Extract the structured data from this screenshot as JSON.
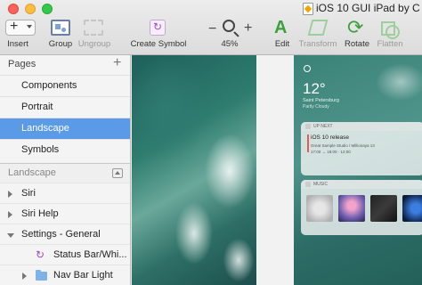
{
  "window": {
    "title": "iOS 10 GUI iPad by C"
  },
  "toolbar": {
    "insert_label": "Insert",
    "group_label": "Group",
    "ungroup_label": "Ungroup",
    "create_symbol_label": "Create Symbol",
    "zoom_minus": "−",
    "zoom_plus": "+",
    "zoom_level": "45%",
    "edit_label": "Edit",
    "transform_label": "Transform",
    "rotate_label": "Rotate",
    "flatten_label": "Flatten",
    "icons": [
      "plus-icon",
      "group-icon",
      "ungroup-icon",
      "create-symbol-icon",
      "zoom-icon",
      "edit-icon",
      "transform-icon",
      "rotate-icon",
      "flatten-icon"
    ]
  },
  "sidebar": {
    "pages_title": "Pages",
    "pages": [
      {
        "label": "Components"
      },
      {
        "label": "Portrait"
      },
      {
        "label": "Landscape",
        "selected": true
      },
      {
        "label": "Symbols"
      }
    ],
    "layers_title": "Landscape",
    "layers": [
      {
        "label": "Siri"
      },
      {
        "label": "Siri Help"
      },
      {
        "label": "Settings - General",
        "expanded": true
      },
      {
        "label": "Status Bar/Whi..."
      },
      {
        "label": "Nav Bar Light"
      }
    ]
  },
  "canvas": {
    "temperature": "12°",
    "city": "Saint Petersburg",
    "weather_detail": "Partly Cloudy",
    "up_next_header": "UP NEXT",
    "event_title": "iOS 10 release",
    "event_line1": "Great Sample Studio / Millionaya 13",
    "event_line2": "17:00 → 18:00 · 12:00",
    "music_header": "MUSIC"
  },
  "colors": {
    "selection": "#5b9ae6",
    "accent_green": "#3ca13c",
    "symbol_purple": "#a04cc2"
  }
}
